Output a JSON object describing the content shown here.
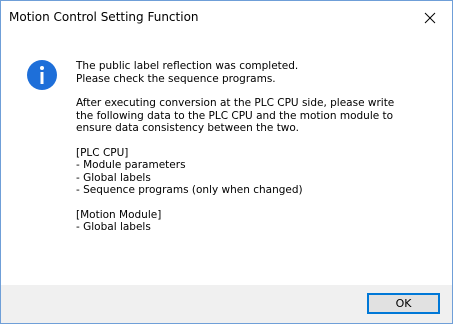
{
  "window": {
    "title": "Motion Control Setting Function",
    "close_icon": "close-icon",
    "border_color": "#6f9fd8"
  },
  "icon": {
    "name": "info-icon",
    "color": "#1e6fd9"
  },
  "message": {
    "para1": [
      "The public label reflection was completed.",
      "Please check the sequence programs."
    ],
    "para2": [
      "After executing conversion at the PLC CPU side, please write",
      "the following data to the PLC CPU and the motion module to",
      "ensure data consistency between the two."
    ],
    "para3": [
      "[PLC CPU]",
      "- Module parameters",
      "- Global labels",
      "- Sequence programs (only when changed)"
    ],
    "para4": [
      "[Motion Module]",
      "- Global labels"
    ]
  },
  "buttons": {
    "ok_label": "OK"
  }
}
